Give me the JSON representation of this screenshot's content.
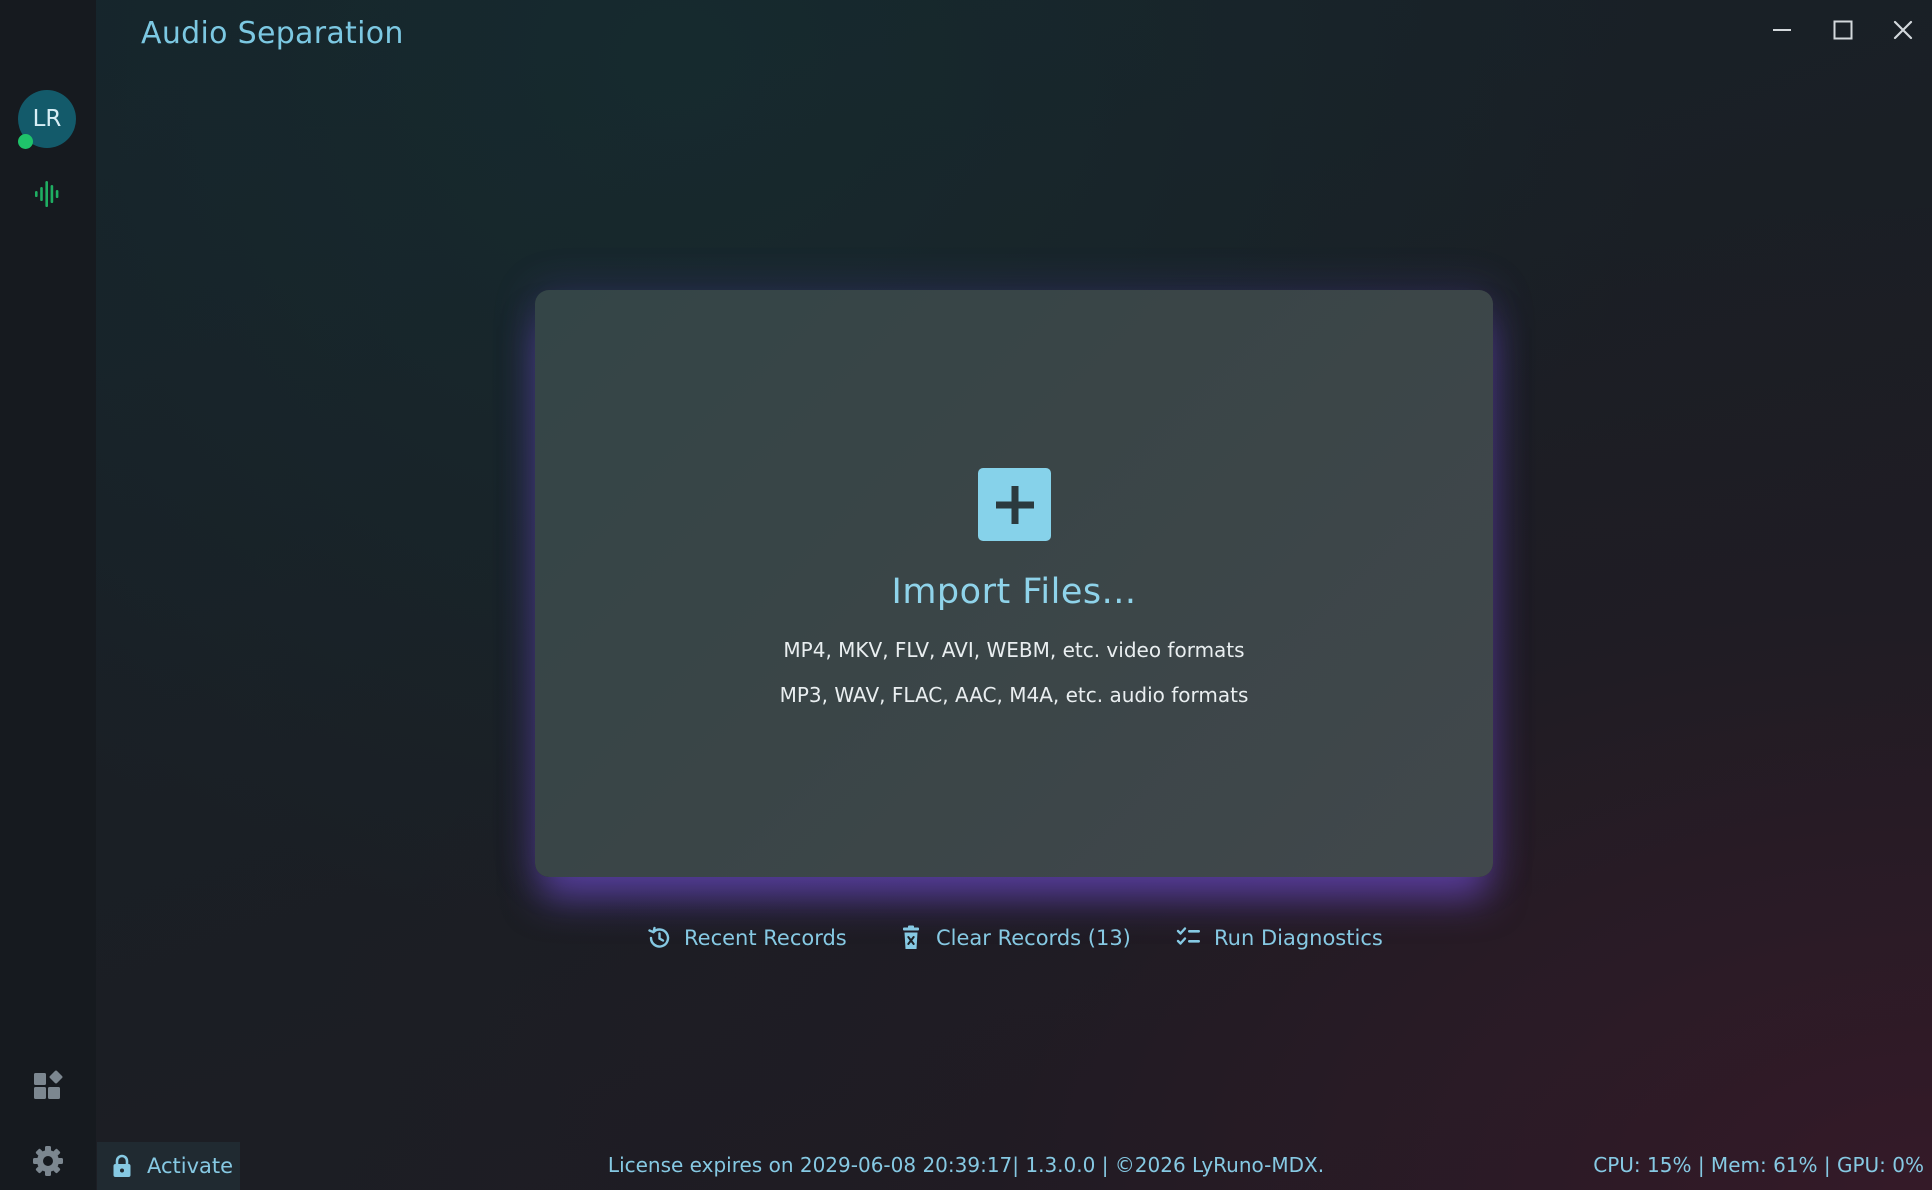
{
  "app": {
    "title": "Audio Separation"
  },
  "sidebar": {
    "avatar_initials": "LR",
    "status": "online",
    "items": [
      {
        "name": "audio-waveform",
        "icon": "audio-waveform-icon"
      },
      {
        "name": "widgets",
        "icon": "widgets-icon"
      },
      {
        "name": "settings",
        "icon": "gear-icon"
      }
    ]
  },
  "window_controls": [
    "minimize",
    "maximize",
    "close"
  ],
  "import": {
    "label": "Import Files...",
    "video_formats": "MP4, MKV, FLV, AVI, WEBM, etc. video formats",
    "audio_formats": "MP3, WAV, FLAC, AAC, M4A, etc. audio formats"
  },
  "actions": {
    "recent": "Recent Records",
    "clear": "Clear Records (13)",
    "diagnostics": "Run Diagnostics"
  },
  "footer": {
    "activate": "Activate",
    "license": "License expires on 2029-06-08 20:39:17| 1.3.0.0 | ©2026 LyRuno-MDX.",
    "stats": "CPU: 15% | Mem: 61% | GPU: 0%"
  },
  "colors": {
    "accent": "#86c9e3",
    "title": "#7cc8e2",
    "green": "#1fc36a",
    "avatar": "#135a6a",
    "plus_box": "#86d2ea",
    "glow": "#7a52e6"
  }
}
